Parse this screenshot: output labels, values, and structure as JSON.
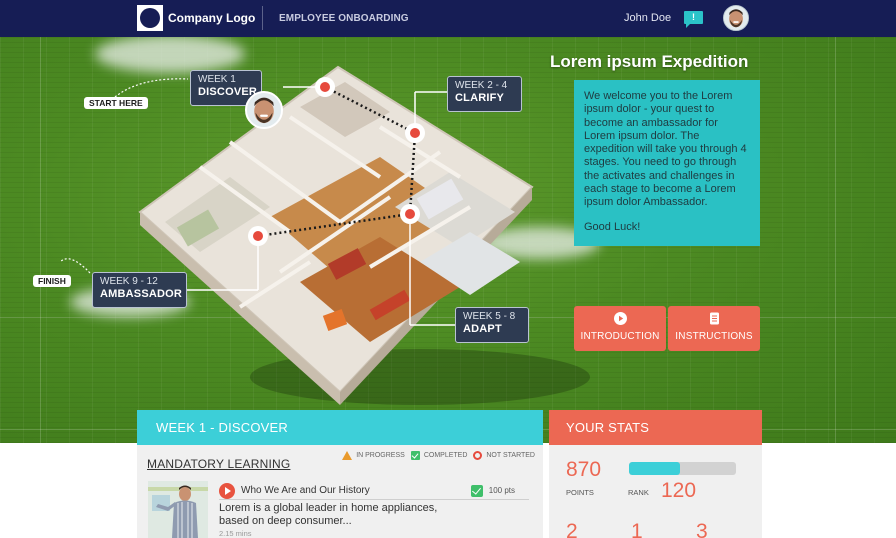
{
  "header": {
    "logo_text": "Company Logo",
    "app_title": "EMPLOYEE ONBOARDING",
    "user_name": "John Doe",
    "notification_badge": "!",
    "avatar_icon": "user-avatar-icon"
  },
  "journey": {
    "start_label": "START HERE",
    "finish_label": "FINISH",
    "stages": [
      {
        "week": "WEEK 1",
        "name": "DISCOVER"
      },
      {
        "week": "WEEK 2 - 4",
        "name": "CLARIFY"
      },
      {
        "week": "WEEK 5 - 8",
        "name": "ADAPT"
      },
      {
        "week": "WEEK 9 - 12",
        "name": "AMBASSADOR"
      }
    ]
  },
  "expedition": {
    "title": "Lorem ipsum Expedition",
    "body": "We welcome you to the Lorem ipsum dolor - your quest to become an ambassador for Lorem ipsum dolor. The expedition will take you through 4 stages. You need to go through the activates and challenges in each stage to become a Lorem ipsum dolor Ambassador.",
    "closing": "Good Luck!",
    "buttons": [
      {
        "label": "INTRODUCTION",
        "icon": "play-icon"
      },
      {
        "label": "INSTRUCTIONS",
        "icon": "document-icon"
      }
    ]
  },
  "learning_panel": {
    "title": "WEEK 1 - DISCOVER",
    "section_title": "MANDATORY LEARNING",
    "legend": {
      "in_progress": "IN PROGRESS",
      "completed": "COMPLETED",
      "not_started": "NOT STARTED"
    },
    "items": [
      {
        "title": "Who We Are and Our History",
        "status": "completed",
        "points": "100 pts",
        "description": "Lorem is a global leader in home appliances, based on deep consumer...",
        "duration": "2.15 mins"
      }
    ]
  },
  "stats_panel": {
    "title": "YOUR STATS",
    "points_value": "870",
    "points_label": "POINTS",
    "rank_label": "RANK",
    "rank_value": "120",
    "rank_progress_percent": 48,
    "counts": [
      "2",
      "1",
      "3"
    ]
  },
  "colors": {
    "header_bg": "#161d55",
    "teal": "#3ccfd8",
    "coral": "#ec6853",
    "marker_red": "#e64a3d"
  }
}
